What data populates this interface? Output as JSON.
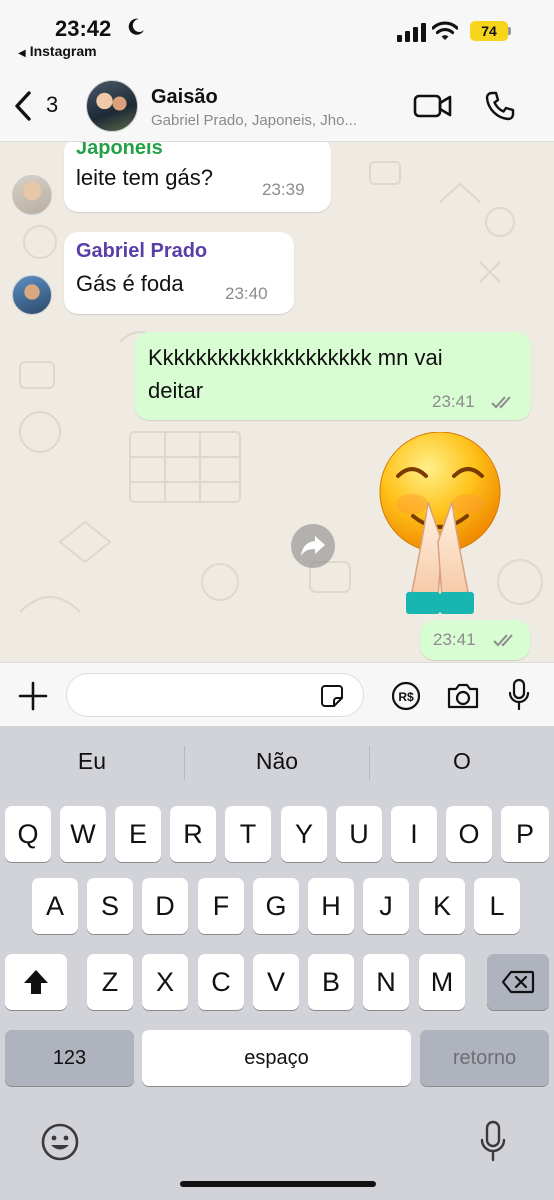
{
  "status_bar": {
    "time": "23:42",
    "back_app": "Instagram",
    "battery": "74"
  },
  "header": {
    "unread_count": "3",
    "group_name": "Gaisão",
    "members": "Gabriel Prado, Japoneis, Jho..."
  },
  "messages": [
    {
      "sender": "Japoneis",
      "sender_color": "#24a148",
      "text": "leite tem gás?",
      "time": "23:39",
      "direction": "incoming"
    },
    {
      "sender": "Gabriel Prado",
      "sender_color": "#5a3ea8",
      "text": "Gás é foda",
      "time": "23:40",
      "direction": "incoming"
    },
    {
      "text_line1": "Kkkkkkkkkkkkkkkkkkkk mn vai",
      "text_line2": "deitar",
      "time": "23:41",
      "direction": "outgoing"
    },
    {
      "sticker": "smiling-emoji-praying-hands",
      "time": "23:41",
      "direction": "outgoing"
    }
  ],
  "input": {
    "placeholder": ""
  },
  "keyboard": {
    "suggestions": [
      "Eu",
      "Não",
      "O"
    ],
    "row1": [
      "Q",
      "W",
      "E",
      "R",
      "T",
      "Y",
      "U",
      "I",
      "O",
      "P"
    ],
    "row2": [
      "A",
      "S",
      "D",
      "F",
      "G",
      "H",
      "J",
      "K",
      "L"
    ],
    "row3": [
      "Z",
      "X",
      "C",
      "V",
      "B",
      "N",
      "M"
    ],
    "numbers_key": "123",
    "space_key": "espaço",
    "return_key": "retorno"
  },
  "colors": {
    "incoming_bubble": "#ffffff",
    "outgoing_bubble": "#d9fdd3",
    "battery": "#f7d51d",
    "keyboard_bg": "#d1d3d9"
  }
}
